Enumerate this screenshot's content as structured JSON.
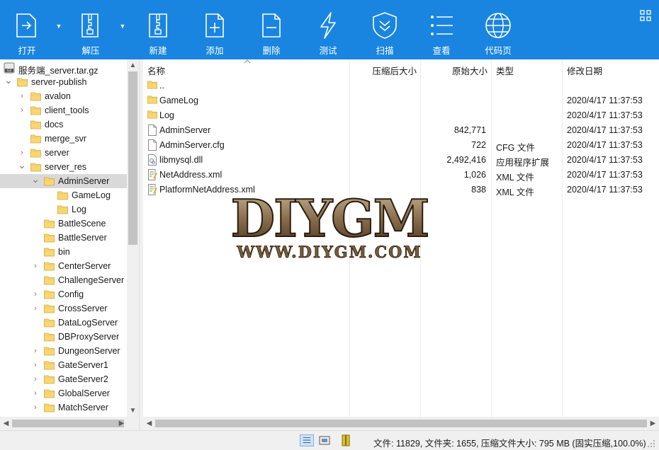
{
  "toolbar": {
    "buttons": [
      {
        "label": "打开",
        "icon": "open-icon"
      },
      {
        "label": "解压",
        "icon": "extract-icon"
      },
      {
        "label": "新建",
        "icon": "new-archive-icon"
      },
      {
        "label": "添加",
        "icon": "add-icon"
      },
      {
        "label": "删除",
        "icon": "delete-icon"
      },
      {
        "label": "测试",
        "icon": "test-icon"
      },
      {
        "label": "扫描",
        "icon": "scan-icon"
      },
      {
        "label": "查看",
        "icon": "view-icon"
      },
      {
        "label": "代码页",
        "icon": "codepage-icon"
      }
    ],
    "color": "#1a85e0"
  },
  "tree": {
    "root": "服务端_server.tar.gz",
    "items": [
      {
        "label": "server-publish"
      },
      {
        "label": "avalon"
      },
      {
        "label": "client_tools"
      },
      {
        "label": "docs"
      },
      {
        "label": "merge_svr"
      },
      {
        "label": "server"
      },
      {
        "label": "server_res"
      },
      {
        "label": "AdminServer"
      },
      {
        "label": "GameLog"
      },
      {
        "label": "Log"
      },
      {
        "label": "BattleScene"
      },
      {
        "label": "BattleServer"
      },
      {
        "label": "bin"
      },
      {
        "label": "CenterServer"
      },
      {
        "label": "ChallengeServer"
      },
      {
        "label": "Config"
      },
      {
        "label": "CrossServer"
      },
      {
        "label": "DataLogServer"
      },
      {
        "label": "DBProxyServer"
      },
      {
        "label": "DungeonServer"
      },
      {
        "label": "GateServer1"
      },
      {
        "label": "GateServer2"
      },
      {
        "label": "GlobalServer"
      },
      {
        "label": "MatchServer"
      }
    ]
  },
  "list": {
    "columns": {
      "name": "名称",
      "compressed": "压缩后大小",
      "original": "原始大小",
      "type": "类型",
      "modified": "修改日期"
    },
    "rows": [
      {
        "name": "..",
        "compressed": "",
        "original": "",
        "type": "",
        "modified": "",
        "icon": "folder-icon"
      },
      {
        "name": "GameLog",
        "compressed": "",
        "original": "",
        "type": "",
        "modified": "2020/4/17 11:37:53",
        "icon": "folder-icon"
      },
      {
        "name": "Log",
        "compressed": "",
        "original": "",
        "type": "",
        "modified": "2020/4/17 11:37:53",
        "icon": "folder-icon"
      },
      {
        "name": "AdminServer",
        "compressed": "",
        "original": "842,771",
        "type": "",
        "modified": "2020/4/17 11:37:53",
        "icon": "file-icon"
      },
      {
        "name": "AdminServer.cfg",
        "compressed": "",
        "original": "722",
        "type": "CFG 文件",
        "modified": "2020/4/17 11:37:53",
        "icon": "file-icon"
      },
      {
        "name": "libmysql.dll",
        "compressed": "",
        "original": "2,492,416",
        "type": "应用程序扩展",
        "modified": "2020/4/17 11:37:53",
        "icon": "dll-icon"
      },
      {
        "name": "NetAddress.xml",
        "compressed": "",
        "original": "1,026",
        "type": "XML 文件",
        "modified": "2020/4/17 11:37:53",
        "icon": "xml-file-icon"
      },
      {
        "name": "PlatformNetAddress.xml",
        "compressed": "",
        "original": "838",
        "type": "XML 文件",
        "modified": "2020/4/17 11:37:53",
        "icon": "xml-file-icon"
      }
    ]
  },
  "watermark": {
    "title": "DIYGM",
    "url": "WWW.DIYGM.COM"
  },
  "status": {
    "text": "文件: 11829, 文件夹: 1655, 压缩文件大小: 795 MB (固实压缩,100.0%)"
  }
}
